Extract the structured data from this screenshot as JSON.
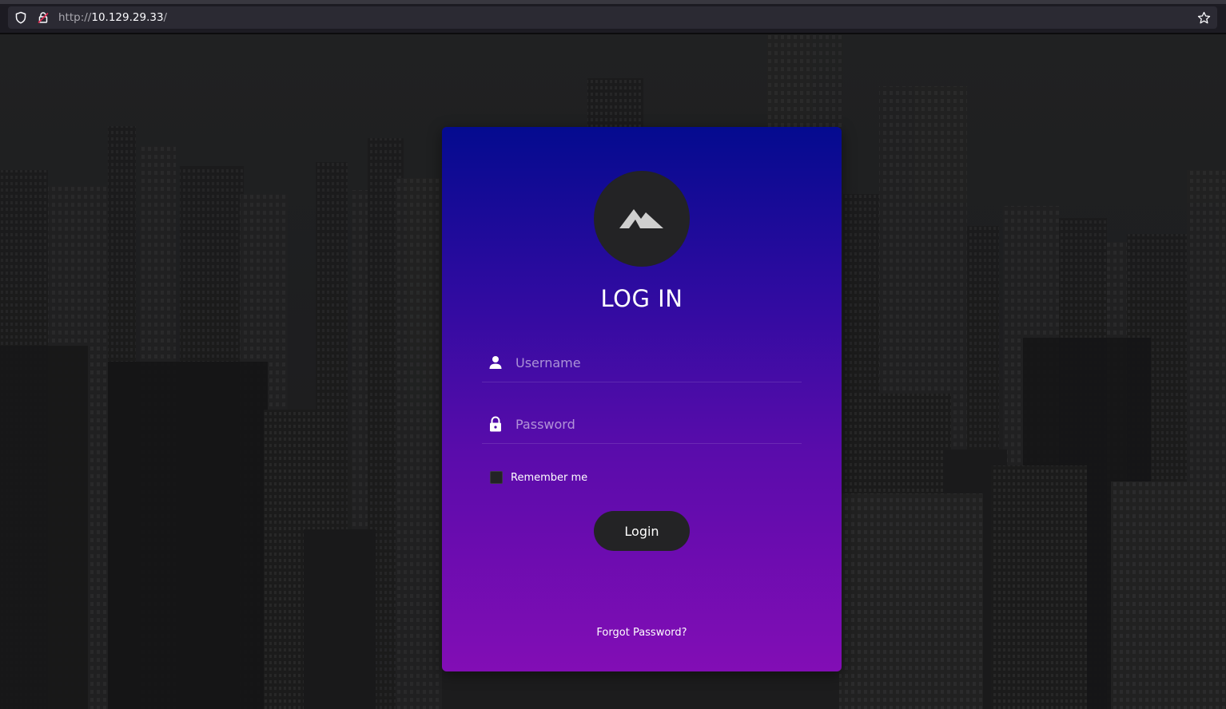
{
  "browser": {
    "url_protocol": "http://",
    "url_host": "10.129.29.33",
    "url_path": "/"
  },
  "login": {
    "title": "LOG IN",
    "username_placeholder": "Username",
    "password_placeholder": "Password",
    "remember_label": "Remember me",
    "login_button": "Login",
    "forgot_link": "Forgot Password?"
  },
  "colors": {
    "card_gradient_top": "#040b8f",
    "card_gradient_bottom": "#820db5",
    "button_bg": "#232325",
    "page_bg": "#27282a"
  },
  "icons": [
    "shield-icon",
    "insecure-lock-icon",
    "bookmark-star-icon",
    "mountain-logo-icon",
    "user-icon",
    "lock-icon"
  ]
}
